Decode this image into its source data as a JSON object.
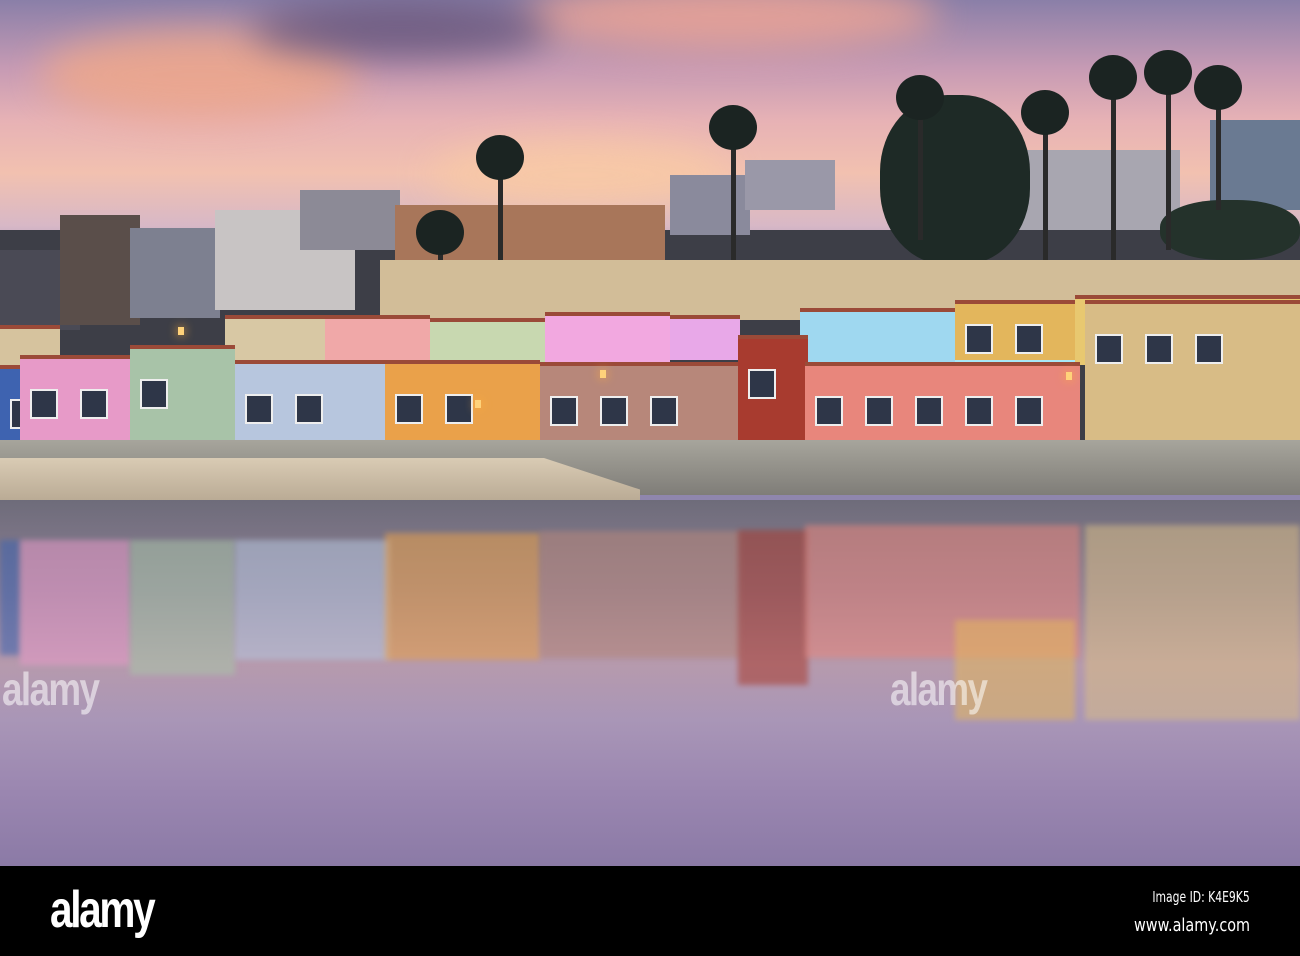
{
  "scene": {
    "sky_colors": [
      "#8a7fa8",
      "#f2c1b0",
      "#e7a58f"
    ],
    "row_house_colors": [
      "#3e63b0",
      "#e79ac8",
      "#a8c3a8",
      "#b7c6de",
      "#eaa14a",
      "#b7877a",
      "#a83b2f",
      "#e8867c",
      "#e3b65c",
      "#d8bc86"
    ],
    "upper_house_colors": [
      "#d8c8a4",
      "#f0a8a8",
      "#c8d8b0",
      "#f2a8e0",
      "#e8a8e8",
      "#9fd8f0",
      "#a8e8f8",
      "#e8c870",
      "#d6c39e"
    ]
  },
  "watermarks": [
    "alamy",
    "alamy"
  ],
  "footer": {
    "logo": "alamy",
    "image_id": "Image ID: K4E9K5",
    "site": "www.alamy.com"
  }
}
